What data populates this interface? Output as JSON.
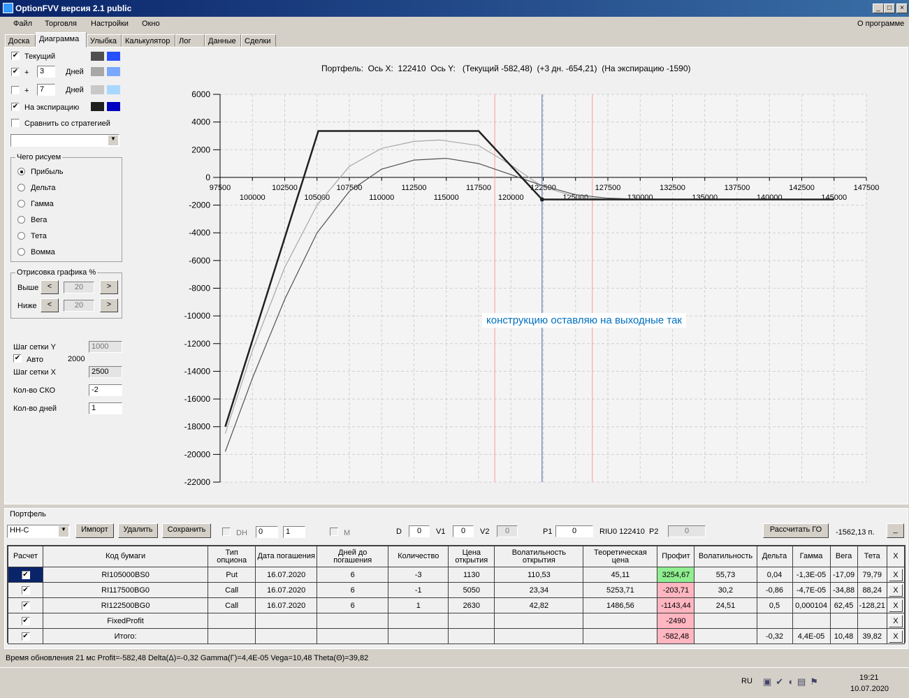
{
  "app": {
    "title": "OptionFVV версия 2.1 public"
  },
  "menu": [
    "Файл",
    "Торговля",
    "Настройки",
    "Окно"
  ],
  "about": "О программе",
  "tabs": [
    "Доска",
    "Диаграмма",
    "Улыбка",
    "Калькулятор",
    "Лог",
    "Данные",
    "Сделки"
  ],
  "left": {
    "current": "Текущий",
    "plus": "+",
    "days": "Дней",
    "plus3": "3",
    "plus7": "7",
    "expiration": "На экспирацию",
    "compare": "Сравнить со стратегией",
    "colors": {
      "current": [
        "#505050",
        "#2850ff"
      ],
      "plus3": [
        "#a8a8a8",
        "#7aa8ff"
      ],
      "plus7": [
        "#c8c8c8",
        "#a8d8ff"
      ],
      "expiration": [
        "#202020",
        "#0000c0"
      ]
    },
    "draw_group": "Чего рисуем",
    "draw_options": [
      "Прибыль",
      "Дельта",
      "Гамма",
      "Вега",
      "Тета",
      "Вомма"
    ],
    "draw_selected": "Прибыль",
    "render_group": "Отрисовка графика %",
    "above": "Выше",
    "below": "Ниже",
    "above_val": "20",
    "below_val": "20",
    "lt": "<",
    "gt": ">",
    "grid_y": "Шаг сетки Y",
    "grid_y_val": "1000",
    "auto": "Авто",
    "auto_val": "2000",
    "grid_x": "Шаг сетки X",
    "grid_x_val": "2500",
    "sko": "Кол-во СКО",
    "sko_val": "-2",
    "ndays": "Кол-во дней",
    "ndays_val": "1"
  },
  "chart_header": "Портфель:  Ось X:  122410  Ось Y:   (Текущий -582,48)  (+3 дн. -654,21)  (На экспирацию -1590)",
  "annotation": "конструкцию оставляю на выходные так",
  "chart_data": {
    "type": "line",
    "xlim": [
      97500,
      147500
    ],
    "ylim": [
      -22000,
      6000
    ],
    "xticks_upper": [
      "97500",
      "102500",
      "107500",
      "112500",
      "117500",
      "122500",
      "127500",
      "132500",
      "137500",
      "142500",
      "147500"
    ],
    "xticks_lower": [
      "100000",
      "105000",
      "110000",
      "115000",
      "120000",
      "125000",
      "130000",
      "135000",
      "140000",
      "145000"
    ],
    "yticks": [
      "6000",
      "4000",
      "2000",
      "0",
      "-2000",
      "-4000",
      "-6000",
      "-8000",
      "-10000",
      "-12000",
      "-14000",
      "-16000",
      "-18000",
      "-20000",
      "-22000"
    ],
    "grid": true,
    "vlines": [
      {
        "x": 118750,
        "color": "#ff9999"
      },
      {
        "x": 122410,
        "color": "#4060a0"
      },
      {
        "x": 126300,
        "color": "#ff9999"
      }
    ],
    "series": [
      {
        "key": "plus3",
        "color": "#a8a8a8",
        "x": [
          97900,
          100000,
          102500,
          105000,
          107500,
          110000,
          112500,
          114500,
          117500,
          120000,
          122410,
          125000,
          127500,
          145000
        ],
        "y": [
          -18500,
          -12500,
          -6500,
          -2000,
          800,
          2100,
          2600,
          2700,
          2300,
          900,
          -654,
          -1400,
          -1580,
          -1590
        ]
      },
      {
        "key": "current",
        "color": "#505050",
        "x": [
          97900,
          100000,
          102500,
          105000,
          107500,
          110000,
          112500,
          115000,
          117500,
          120000,
          122410,
          125000,
          127500,
          130000,
          145000
        ],
        "y": [
          -19800,
          -14500,
          -8800,
          -4000,
          -1000,
          600,
          1250,
          1380,
          1000,
          200,
          -582,
          -1250,
          -1500,
          -1580,
          -1590
        ]
      },
      {
        "key": "expiration",
        "color": "#202020",
        "x": [
          97900,
          105100,
          117500,
          122410,
          145000
        ],
        "y": [
          -18000,
          3350,
          3350,
          -1590,
          -1590
        ]
      }
    ]
  },
  "portfolio": {
    "label": "Портфель",
    "select": "НН-С",
    "import": "Импорт",
    "delete": "Удалить",
    "save": "Сохранить",
    "dh": "DH",
    "spin1": "0",
    "spin2": "1",
    "m": "M",
    "d": "D",
    "d_val": "0",
    "v1": "V1",
    "v1_val": "0",
    "v2": "V2",
    "v2_val": "0",
    "p1": "P1",
    "p1_val": "0",
    "riu": "RIU0 122410",
    "p2": "P2",
    "p2_val": "0",
    "calc_go": "Рассчитать ГО",
    "go_val": "-1562,13 п.",
    "min": "_"
  },
  "table": {
    "headers": [
      "Расчет",
      "Код бумаги",
      "Тип опциона",
      "Дата погашения",
      "Дней до погашения",
      "Количество",
      "Цена открытия",
      "Волатильность открытия",
      "Теоретическая цена",
      "Профит",
      "Волатильность",
      "Дельта",
      "Гамма",
      "Вега",
      "Тета",
      "X"
    ],
    "rows": [
      [
        "RI105000BS0",
        "Put",
        "16.07.2020",
        "6",
        "-3",
        "1130",
        "110,53",
        "45,11",
        "3254,67",
        "55,73",
        "0,04",
        "-1,3E-05",
        "-17,09",
        "79,79"
      ],
      [
        "RI117500BG0",
        "Call",
        "16.07.2020",
        "6",
        "-1",
        "5050",
        "23,34",
        "5253,71",
        "-203,71",
        "30,2",
        "-0,86",
        "-4,7E-05",
        "-34,88",
        "88,24"
      ],
      [
        "RI122500BG0",
        "Call",
        "16.07.2020",
        "6",
        "1",
        "2630",
        "42,82",
        "1486,56",
        "-1143,44",
        "24,51",
        "0,5",
        "0,000104",
        "62,45",
        "-128,21"
      ],
      [
        "FixedProfit",
        "",
        "",
        "",
        "",
        "",
        "",
        "",
        "-2490",
        "",
        "",
        "",
        "",
        ""
      ],
      [
        "Итого:",
        "",
        "",
        "",
        "",
        "",
        "",
        "",
        "-582,48",
        "",
        "-0,32",
        "4,4E-05",
        "10,48",
        "39,82"
      ]
    ],
    "profit_colors": [
      "green",
      "pink",
      "pink",
      "pink",
      "pink"
    ],
    "x": "X"
  },
  "status": "Время обновления 21 мс  Profit=-582,48 Delta(Δ)=-0,32 Gamma(Γ)=4,4E-05 Vega=10,48 Theta(Θ)=39,82",
  "taskbar": {
    "lang": "RU",
    "time": "19:21",
    "date": "10.07.2020"
  }
}
